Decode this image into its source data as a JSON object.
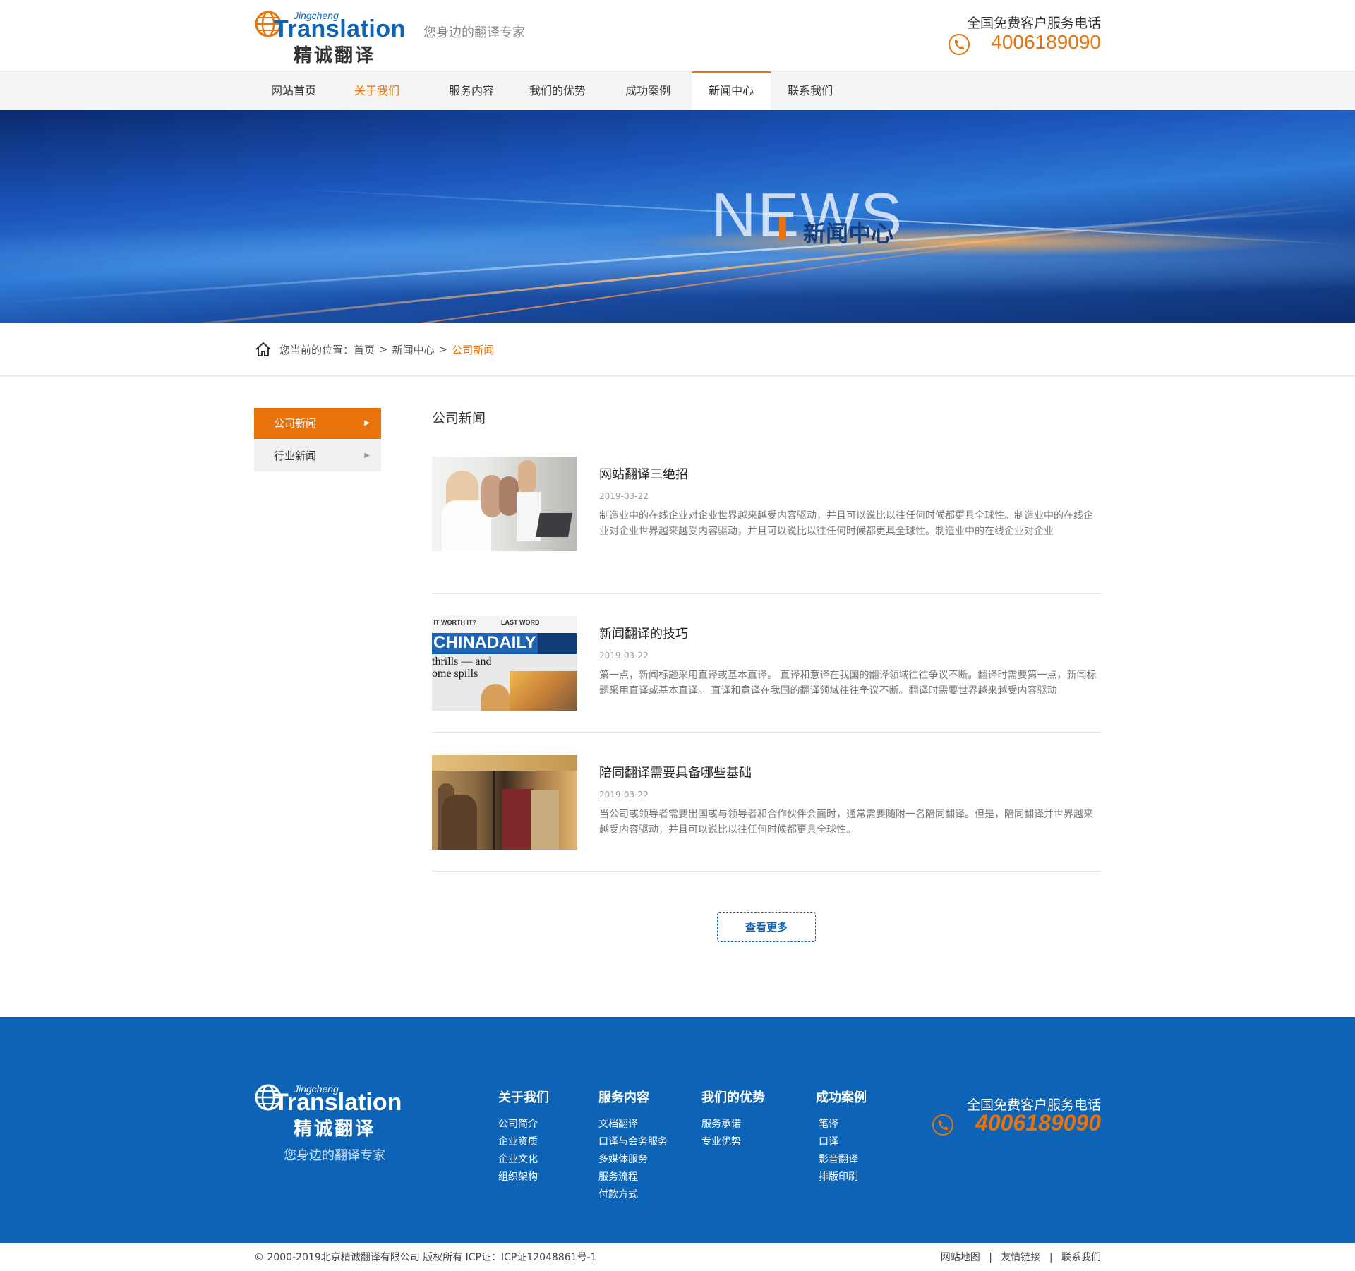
{
  "header": {
    "logo_en_small": "Jingcheng",
    "logo_en": "Translation",
    "logo_cn": "精诚翻译",
    "slogan": "您身边的翻译专家",
    "hotline_label": "全国免费客户服务电话",
    "hotline_number": "4006189090"
  },
  "nav": [
    {
      "label": "网站首页"
    },
    {
      "label": "关于我们"
    },
    {
      "label": "服务内容"
    },
    {
      "label": "我们的优势"
    },
    {
      "label": "成功案例"
    },
    {
      "label": "新闻中心"
    },
    {
      "label": "联系我们"
    }
  ],
  "banner": {
    "title": "NEWS",
    "subtitle": "新闻中心"
  },
  "breadcrumb": {
    "prefix": "您当前的位置：",
    "home": "首页",
    "sep": ">",
    "section": "新闻中心",
    "current": "公司新闻"
  },
  "sidenav": [
    {
      "label": "公司新闻"
    },
    {
      "label": "行业新闻"
    }
  ],
  "content": {
    "title": "公司新闻",
    "news": [
      {
        "title": "网站翻译三绝招",
        "date": "2019-03-22",
        "desc": "制造业中的在线企业对企业世界越来越受内容驱动，并且可以说比以往任何时候都更具全球性。制造业中的在线企业对企业世界越来越受内容驱动，并且可以说比以往任何时候都更具全球性。制造业中的在线企业对企业"
      },
      {
        "title": "新闻翻译的技巧",
        "date": "2019-03-22",
        "desc": "第一点，新闻标题采用直译或基本直译。 直译和意译在我国的翻译领域往往争议不断。翻译时需要第一点，新闻标题采用直译或基本直译。 直译和意译在我国的翻译领域往往争议不断。翻译时需要世界越来越受内容驱动"
      },
      {
        "title": "陪同翻译需要具备哪些基础",
        "date": "2019-03-22",
        "desc": "当公司或领导者需要出国或与领导者和合作伙伴会面时，通常需要随附一名陪同翻译。但是，陪同翻译并世界越来越受内容驱动，并且可以说比以往任何时候都更具全球性。"
      }
    ],
    "more": "查看更多"
  },
  "footer": {
    "logo_en_small": "Jingcheng",
    "logo_en": "Translation",
    "logo_cn": "精诚翻译",
    "slogan": "您身边的翻译专家",
    "cols": [
      {
        "title": "关于我们",
        "items": [
          "公司简介",
          "企业资质",
          "企业文化",
          "组织架构"
        ]
      },
      {
        "title": "服务内容",
        "items": [
          "文档翻译",
          "口译与会务服务",
          "多媒体服务",
          "服务流程",
          "付款方式"
        ]
      },
      {
        "title": "我们的优势",
        "items": [
          "服务承诺",
          "专业优势"
        ]
      },
      {
        "title": "成功案例",
        "items": [
          "笔译",
          "口译",
          "影音翻译",
          "排版印刷"
        ]
      }
    ],
    "hotline_label": "全国免费客户服务电话",
    "hotline_number": "4006189090"
  },
  "copyright": {
    "text": "© 2000-2019北京精诚翻译有限公司 版权所有 ICP证：ICP证12048861号-1",
    "links": [
      "网站地图",
      "友情链接",
      "联系我们"
    ],
    "sep": "|"
  },
  "colors": {
    "accent": "#e8730a",
    "brand_blue": "#0d63b5"
  },
  "icons": [
    "globe-icon",
    "phone-icon",
    "home-icon",
    "chevron-right-icon"
  ]
}
